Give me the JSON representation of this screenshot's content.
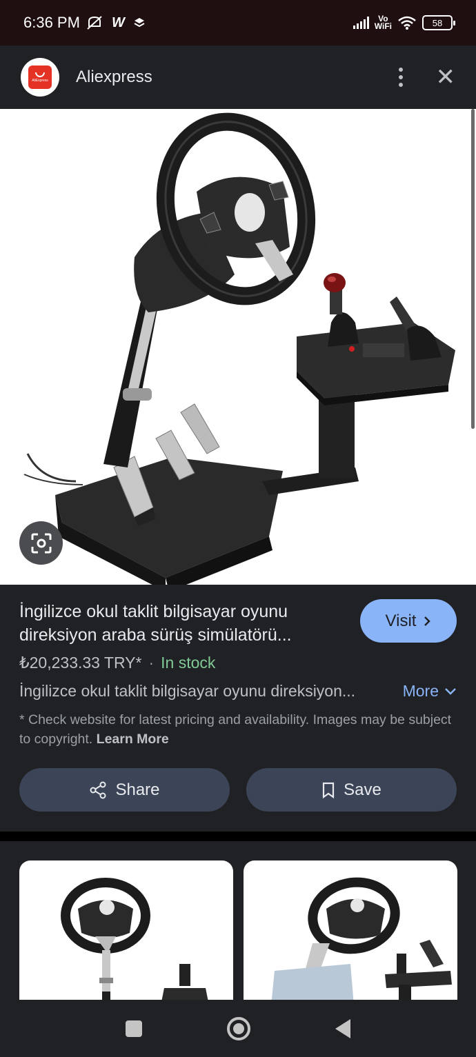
{
  "status_bar": {
    "time": "6:36 PM",
    "w_label": "W",
    "vowifi_top": "Vo",
    "vowifi_bottom": "WiFi",
    "battery": "58"
  },
  "header": {
    "site_name": "Aliexpress",
    "logo_text": "AliExpress"
  },
  "product": {
    "title": "İngilizce okul taklit bilgisayar oyunu direksiyon araba sürüş simülatörü...",
    "visit_label": "Visit",
    "price": "₺20,233.33 TRY*",
    "separator": "·",
    "stock": "In stock",
    "description": "İngilizce okul taklit bilgisayar oyunu direksiyon...",
    "more_label": "More",
    "disclaimer": "* Check website for latest pricing and availability. Images may be subject to copyright.",
    "learn_more": "Learn More"
  },
  "actions": {
    "share_label": "Share",
    "save_label": "Save"
  },
  "colors": {
    "accent": "#8ab4f8",
    "stock_green": "#81c995",
    "pill_bg": "#3c4557",
    "brand_red": "#e43225"
  },
  "icons": [
    "muted-icon",
    "layers-icon",
    "signal-icon",
    "wifi-icon",
    "battery-icon",
    "kebab-icon",
    "close-icon",
    "lens-icon",
    "chevron-right-icon",
    "chevron-down-icon",
    "share-icon",
    "bookmark-icon",
    "nav-recents-icon",
    "nav-home-icon",
    "nav-back-icon"
  ]
}
